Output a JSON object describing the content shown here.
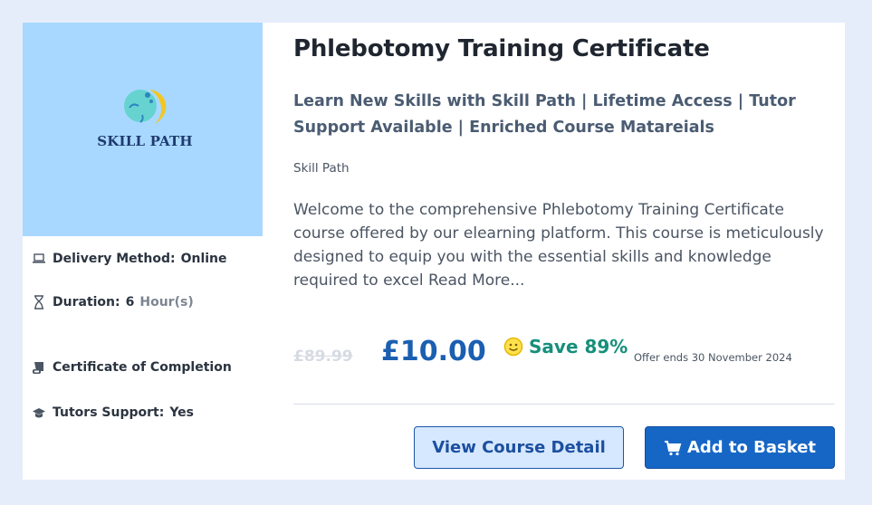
{
  "course": {
    "title": "Phlebotomy Training Certificate",
    "subtitle": "Learn New Skills with Skill Path | Lifetime Access | Tutor Support Available | Enriched Course Matareials",
    "provider": "Skill Path",
    "description": "Welcome to the comprehensive Phlebotomy Training Certificate course offered by our elearning platform. This course is meticulously designed to equip you with the essential skills and knowledge required to excel",
    "read_more": "Read More..."
  },
  "logo": {
    "text": "SKILL PATH"
  },
  "meta": {
    "delivery_label": "Delivery Method:",
    "delivery_value": "Online",
    "duration_label": "Duration:",
    "duration_value": "6",
    "duration_unit": "Hour(s)",
    "certificate_label": "Certificate of Completion",
    "tutor_label": "Tutors Support:",
    "tutor_value": "Yes"
  },
  "pricing": {
    "old_price": "£89.99",
    "price": "£10.00",
    "save_text": "Save 89%",
    "offer_ends": "Offer ends 30 November 2024"
  },
  "buttons": {
    "view_detail": "View Course Detail",
    "add_to_basket": "Add to Basket"
  },
  "colors": {
    "page_bg": "#e5edfb",
    "thumb_bg": "#a8d8ff",
    "price": "#1b5fb1",
    "save": "#178f7c",
    "primary_button": "#1667c5",
    "secondary_button": "#d6e8ff"
  },
  "icons": {
    "delivery": "laptop-icon",
    "duration": "hourglass-icon",
    "certificate": "scroll-icon",
    "tutor": "graduation-cap-icon",
    "save": "smile-icon",
    "basket": "cart-icon"
  }
}
